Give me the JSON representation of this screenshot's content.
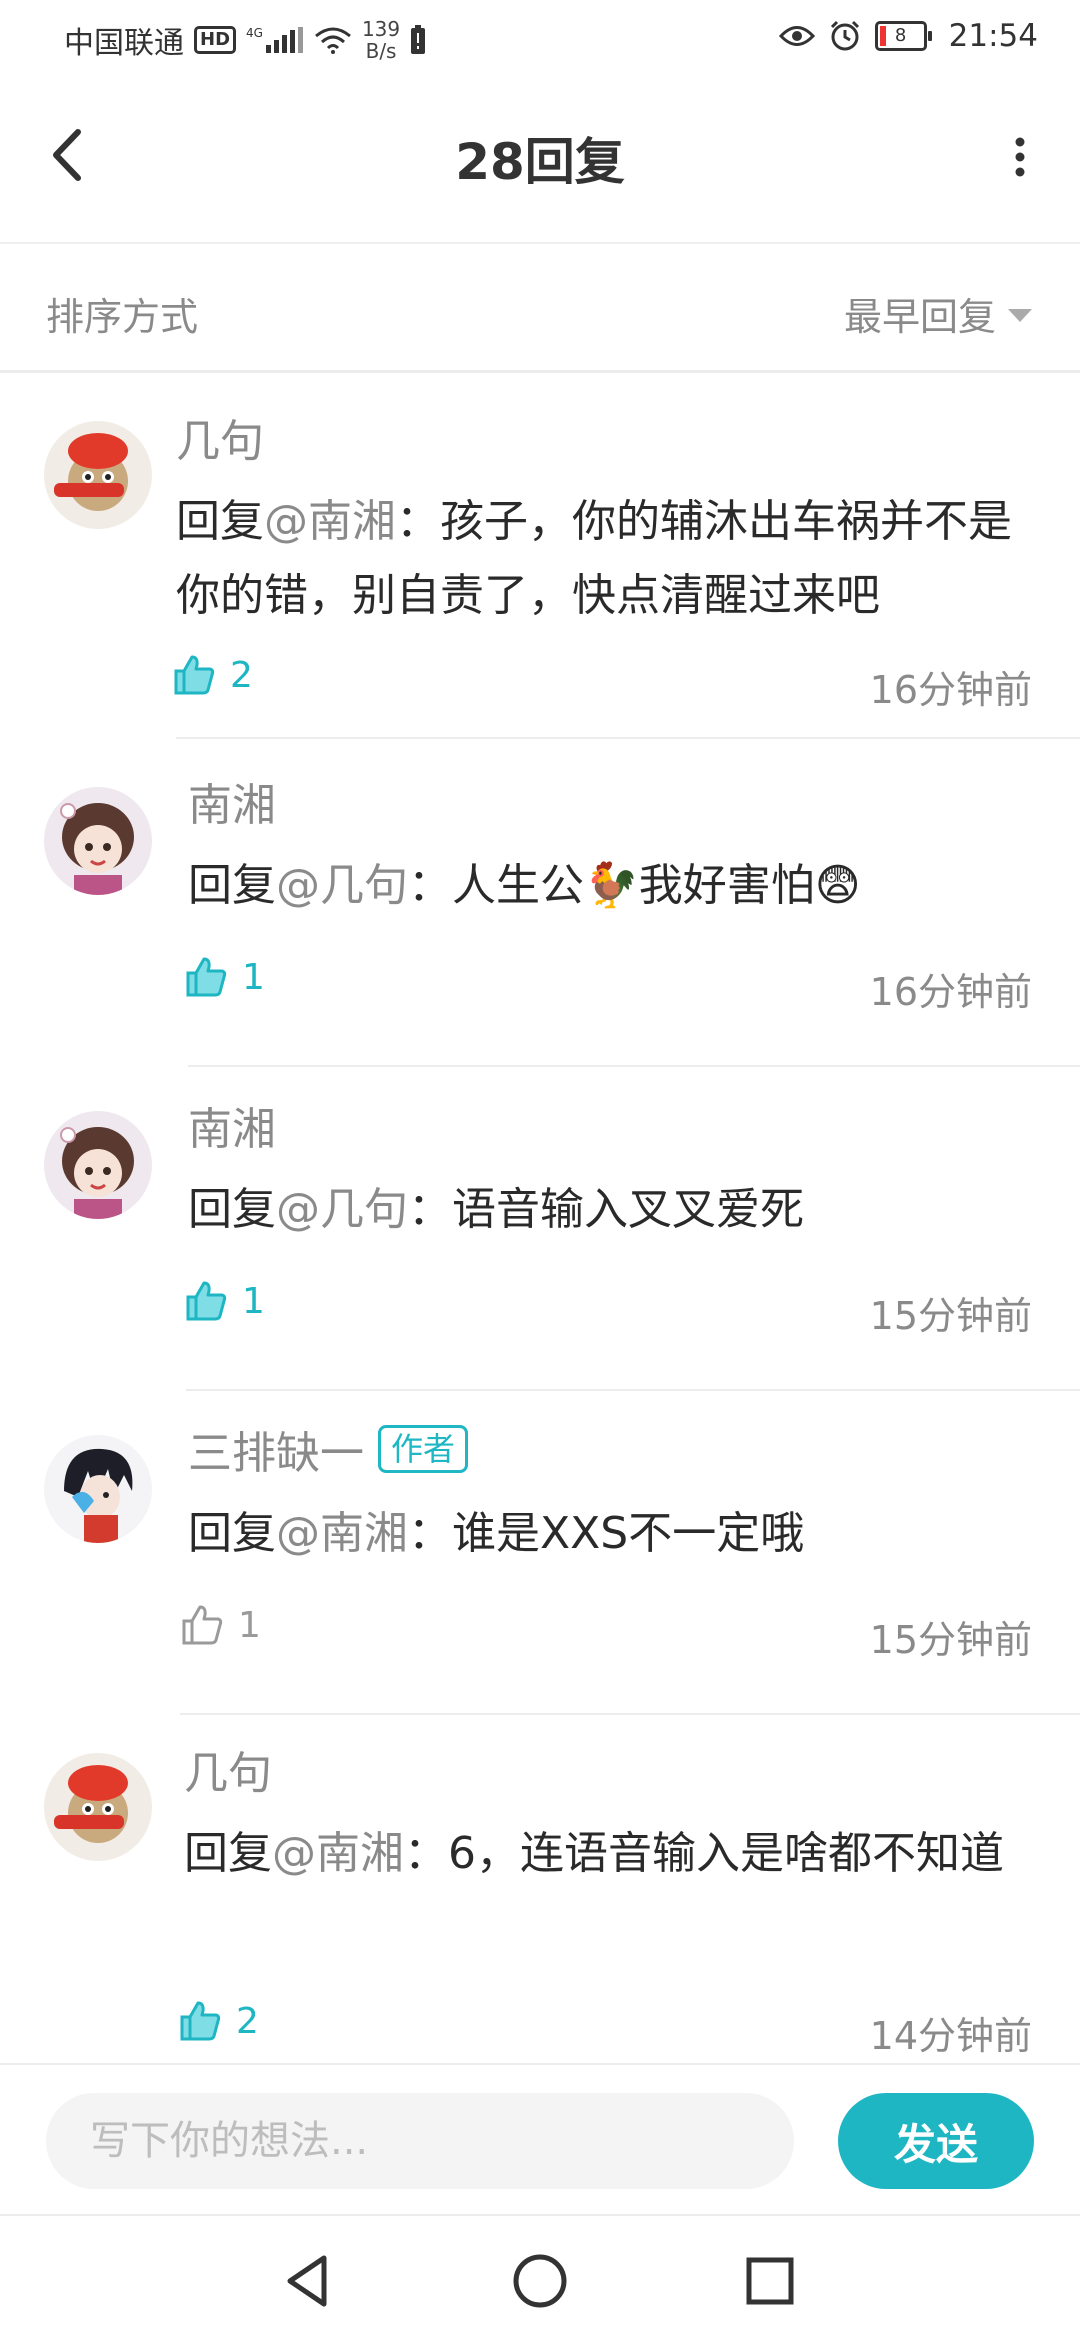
{
  "status_bar": {
    "carrier": "中国联通",
    "hd_badge": "HD",
    "network": "4G",
    "speed_value": "139",
    "speed_unit": "B/s",
    "battery_level": "8",
    "time": "21:54"
  },
  "header": {
    "title": "28回复",
    "back_icon": "chevron-left-icon",
    "more_icon": "more-vertical-icon"
  },
  "sort": {
    "label": "排序方式",
    "selected": "最早回复"
  },
  "comments": [
    {
      "user": "几句",
      "prefix": "回复",
      "mention": "@南湘",
      "text": "：孩子，你的辅沐出车祸并不是你的错，别自责了，快点清醒过来吧",
      "likes": "2",
      "liked": true,
      "time": "16分钟前"
    },
    {
      "user": "南湘",
      "prefix": "回复",
      "mention": "@几句",
      "text": "：人生公🐓我好害怕😨",
      "likes": "1",
      "liked": true,
      "time": "16分钟前"
    },
    {
      "user": "南湘",
      "prefix": "回复",
      "mention": "@几句",
      "text": "：语音输入叉叉爱死",
      "likes": "1",
      "liked": true,
      "time": "15分钟前"
    },
    {
      "user": "三排缺一",
      "badge": "作者",
      "prefix": "回复",
      "mention": "@南湘",
      "text": "：谁是XXS不一定哦",
      "likes": "1",
      "liked": false,
      "time": "15分钟前"
    },
    {
      "user": "几句",
      "prefix": "回复",
      "mention": "@南湘",
      "text": "：6，连语音输入是啥都不知道",
      "likes": "2",
      "liked": true,
      "time": "14分钟前"
    }
  ],
  "input": {
    "placeholder": "写下你的想法...",
    "value": ""
  },
  "send_label": "发送",
  "colors": {
    "accent": "#1fb6c4",
    "muted_text": "#8a8a8a",
    "body_text": "#2a2a2a"
  },
  "nav": {
    "back": "triangle-back-icon",
    "home": "circle-home-icon",
    "recents": "square-recents-icon"
  }
}
